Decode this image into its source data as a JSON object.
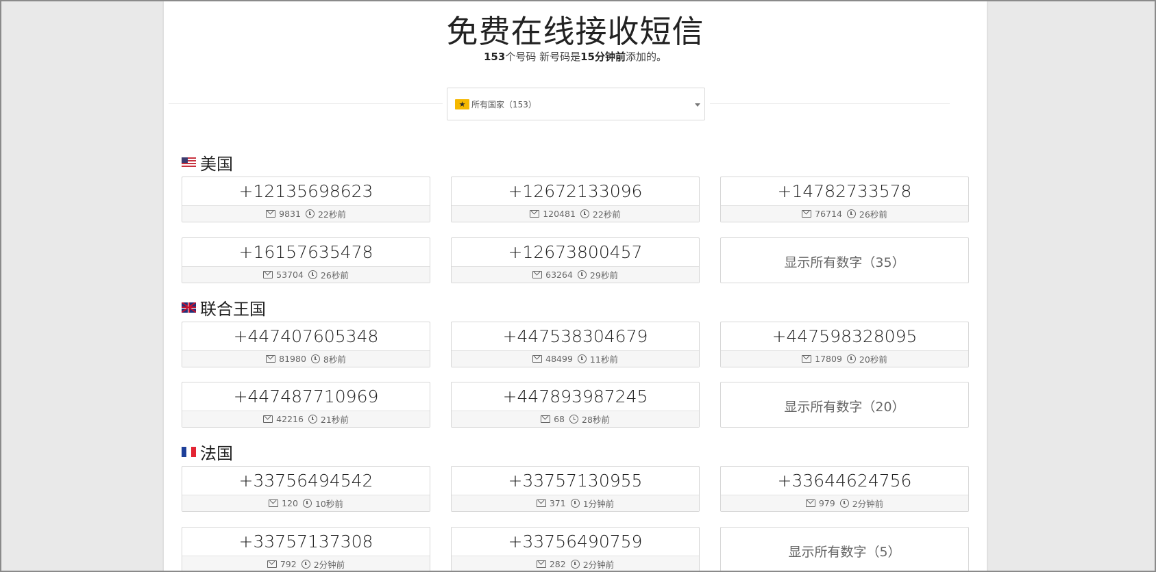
{
  "header": {
    "title": "免费在线接收短信",
    "subtitle_count": "153",
    "subtitle_mid": "个号码 新号码是",
    "subtitle_time": "15分钟前",
    "subtitle_end": "添加的。"
  },
  "country_select": {
    "selected": "所有国家（153）",
    "icon": "star-icon"
  },
  "sections": [
    {
      "name": "美国",
      "flag": "us-flag-icon",
      "numbers": [
        {
          "number": "+12135698623",
          "messages": "9831",
          "time": "22秒前"
        },
        {
          "number": "+12672133096",
          "messages": "120481",
          "time": "22秒前"
        },
        {
          "number": "+14782733578",
          "messages": "76714",
          "time": "26秒前"
        },
        {
          "number": "+16157635478",
          "messages": "53704",
          "time": "26秒前"
        },
        {
          "number": "+12673800457",
          "messages": "63264",
          "time": "29秒前"
        }
      ],
      "show_all": "显示所有数字（35）"
    },
    {
      "name": "联合王国",
      "flag": "uk-flag-icon",
      "numbers": [
        {
          "number": "+447407605348",
          "messages": "81980",
          "time": "8秒前"
        },
        {
          "number": "+447538304679",
          "messages": "48499",
          "time": "11秒前"
        },
        {
          "number": "+447598328095",
          "messages": "17809",
          "time": "20秒前"
        },
        {
          "number": "+447487710969",
          "messages": "42216",
          "time": "21秒前"
        },
        {
          "number": "+447893987245",
          "messages": "68",
          "time": "28秒前"
        }
      ],
      "show_all": "显示所有数字（20）"
    },
    {
      "name": "法国",
      "flag": "france-flag-icon",
      "numbers": [
        {
          "number": "+33756494542",
          "messages": "120",
          "time": "10秒前"
        },
        {
          "number": "+33757130955",
          "messages": "371",
          "time": "1分钟前"
        },
        {
          "number": "+33644624756",
          "messages": "979",
          "time": "2分钟前"
        },
        {
          "number": "+33757137308",
          "messages": "792",
          "time": "2分钟前"
        },
        {
          "number": "+33756490759",
          "messages": "282",
          "time": "2分钟前"
        }
      ],
      "show_all": "显示所有数字（5）"
    }
  ]
}
